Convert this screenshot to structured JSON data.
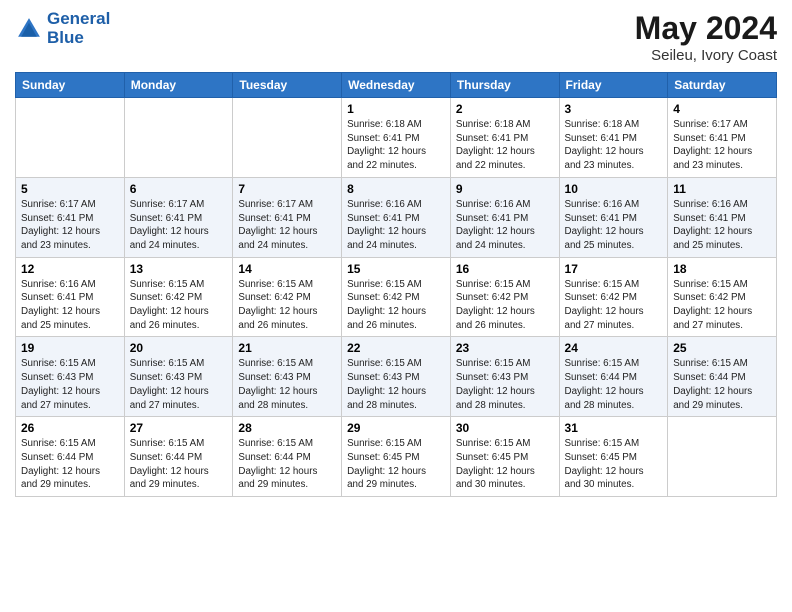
{
  "header": {
    "logo_line1": "General",
    "logo_line2": "Blue",
    "month": "May 2024",
    "location": "Seileu, Ivory Coast"
  },
  "weekdays": [
    "Sunday",
    "Monday",
    "Tuesday",
    "Wednesday",
    "Thursday",
    "Friday",
    "Saturday"
  ],
  "weeks": [
    [
      {
        "day": null,
        "info": null
      },
      {
        "day": null,
        "info": null
      },
      {
        "day": null,
        "info": null
      },
      {
        "day": "1",
        "info": "Sunrise: 6:18 AM\nSunset: 6:41 PM\nDaylight: 12 hours\nand 22 minutes."
      },
      {
        "day": "2",
        "info": "Sunrise: 6:18 AM\nSunset: 6:41 PM\nDaylight: 12 hours\nand 22 minutes."
      },
      {
        "day": "3",
        "info": "Sunrise: 6:18 AM\nSunset: 6:41 PM\nDaylight: 12 hours\nand 23 minutes."
      },
      {
        "day": "4",
        "info": "Sunrise: 6:17 AM\nSunset: 6:41 PM\nDaylight: 12 hours\nand 23 minutes."
      }
    ],
    [
      {
        "day": "5",
        "info": "Sunrise: 6:17 AM\nSunset: 6:41 PM\nDaylight: 12 hours\nand 23 minutes."
      },
      {
        "day": "6",
        "info": "Sunrise: 6:17 AM\nSunset: 6:41 PM\nDaylight: 12 hours\nand 24 minutes."
      },
      {
        "day": "7",
        "info": "Sunrise: 6:17 AM\nSunset: 6:41 PM\nDaylight: 12 hours\nand 24 minutes."
      },
      {
        "day": "8",
        "info": "Sunrise: 6:16 AM\nSunset: 6:41 PM\nDaylight: 12 hours\nand 24 minutes."
      },
      {
        "day": "9",
        "info": "Sunrise: 6:16 AM\nSunset: 6:41 PM\nDaylight: 12 hours\nand 24 minutes."
      },
      {
        "day": "10",
        "info": "Sunrise: 6:16 AM\nSunset: 6:41 PM\nDaylight: 12 hours\nand 25 minutes."
      },
      {
        "day": "11",
        "info": "Sunrise: 6:16 AM\nSunset: 6:41 PM\nDaylight: 12 hours\nand 25 minutes."
      }
    ],
    [
      {
        "day": "12",
        "info": "Sunrise: 6:16 AM\nSunset: 6:41 PM\nDaylight: 12 hours\nand 25 minutes."
      },
      {
        "day": "13",
        "info": "Sunrise: 6:15 AM\nSunset: 6:42 PM\nDaylight: 12 hours\nand 26 minutes."
      },
      {
        "day": "14",
        "info": "Sunrise: 6:15 AM\nSunset: 6:42 PM\nDaylight: 12 hours\nand 26 minutes."
      },
      {
        "day": "15",
        "info": "Sunrise: 6:15 AM\nSunset: 6:42 PM\nDaylight: 12 hours\nand 26 minutes."
      },
      {
        "day": "16",
        "info": "Sunrise: 6:15 AM\nSunset: 6:42 PM\nDaylight: 12 hours\nand 26 minutes."
      },
      {
        "day": "17",
        "info": "Sunrise: 6:15 AM\nSunset: 6:42 PM\nDaylight: 12 hours\nand 27 minutes."
      },
      {
        "day": "18",
        "info": "Sunrise: 6:15 AM\nSunset: 6:42 PM\nDaylight: 12 hours\nand 27 minutes."
      }
    ],
    [
      {
        "day": "19",
        "info": "Sunrise: 6:15 AM\nSunset: 6:43 PM\nDaylight: 12 hours\nand 27 minutes."
      },
      {
        "day": "20",
        "info": "Sunrise: 6:15 AM\nSunset: 6:43 PM\nDaylight: 12 hours\nand 27 minutes."
      },
      {
        "day": "21",
        "info": "Sunrise: 6:15 AM\nSunset: 6:43 PM\nDaylight: 12 hours\nand 28 minutes."
      },
      {
        "day": "22",
        "info": "Sunrise: 6:15 AM\nSunset: 6:43 PM\nDaylight: 12 hours\nand 28 minutes."
      },
      {
        "day": "23",
        "info": "Sunrise: 6:15 AM\nSunset: 6:43 PM\nDaylight: 12 hours\nand 28 minutes."
      },
      {
        "day": "24",
        "info": "Sunrise: 6:15 AM\nSunset: 6:44 PM\nDaylight: 12 hours\nand 28 minutes."
      },
      {
        "day": "25",
        "info": "Sunrise: 6:15 AM\nSunset: 6:44 PM\nDaylight: 12 hours\nand 29 minutes."
      }
    ],
    [
      {
        "day": "26",
        "info": "Sunrise: 6:15 AM\nSunset: 6:44 PM\nDaylight: 12 hours\nand 29 minutes."
      },
      {
        "day": "27",
        "info": "Sunrise: 6:15 AM\nSunset: 6:44 PM\nDaylight: 12 hours\nand 29 minutes."
      },
      {
        "day": "28",
        "info": "Sunrise: 6:15 AM\nSunset: 6:44 PM\nDaylight: 12 hours\nand 29 minutes."
      },
      {
        "day": "29",
        "info": "Sunrise: 6:15 AM\nSunset: 6:45 PM\nDaylight: 12 hours\nand 29 minutes."
      },
      {
        "day": "30",
        "info": "Sunrise: 6:15 AM\nSunset: 6:45 PM\nDaylight: 12 hours\nand 30 minutes."
      },
      {
        "day": "31",
        "info": "Sunrise: 6:15 AM\nSunset: 6:45 PM\nDaylight: 12 hours\nand 30 minutes."
      },
      {
        "day": null,
        "info": null
      }
    ]
  ]
}
